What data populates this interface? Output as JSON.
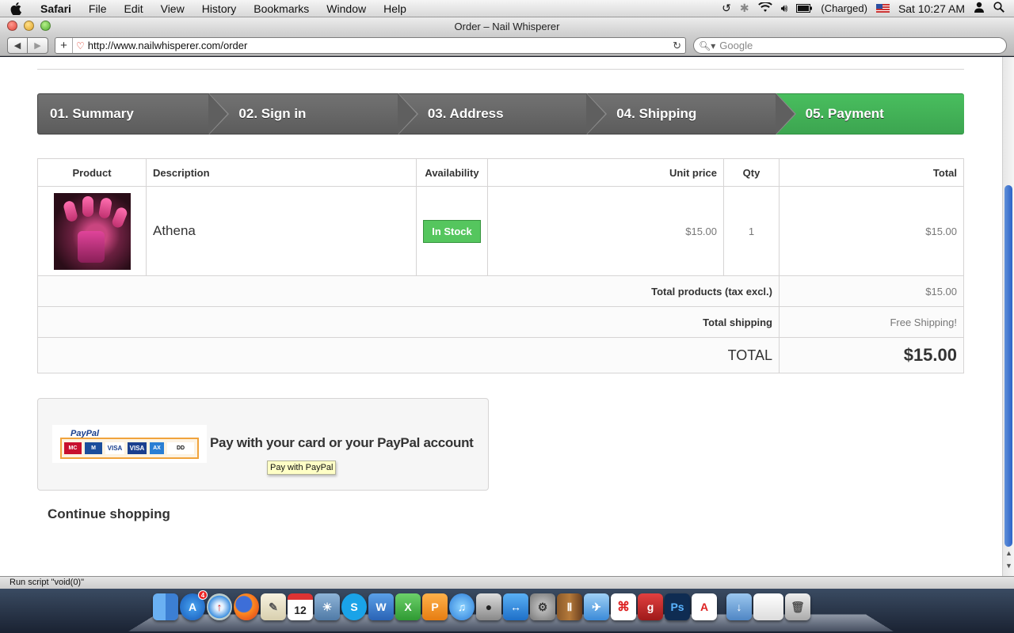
{
  "menubar": {
    "app": "Safari",
    "items": [
      "File",
      "Edit",
      "View",
      "History",
      "Bookmarks",
      "Window",
      "Help"
    ],
    "battery": "(Charged)",
    "clock": "Sat 10:27 AM"
  },
  "window": {
    "title": "Order – Nail Whisperer"
  },
  "toolbar": {
    "url": "http://www.nailwhisperer.com/order",
    "search_placeholder": "Google"
  },
  "steps": [
    {
      "label": "01. Summary",
      "state": "done"
    },
    {
      "label": "02. Sign in",
      "state": "done"
    },
    {
      "label": "03. Address",
      "state": "done"
    },
    {
      "label": "04. Shipping",
      "state": "done"
    },
    {
      "label": "05. Payment",
      "state": "current"
    }
  ],
  "cart": {
    "headers": [
      "Product",
      "Description",
      "Availability",
      "Unit price",
      "Qty",
      "Total"
    ],
    "item": {
      "description": "Athena",
      "availability": "In Stock",
      "unit_price": "$15.00",
      "qty": "1",
      "total": "$15.00"
    },
    "total_products_label": "Total products (tax excl.)",
    "total_products_value": "$15.00",
    "total_shipping_label": "Total shipping",
    "total_shipping_value": "Free Shipping!",
    "grand_total_label": "TOTAL",
    "grand_total_value": "$15.00"
  },
  "payment": {
    "paypal_logo_text": "PayPal",
    "text": "Pay with your card or your PayPal account",
    "tooltip": "Pay with PayPal",
    "cards": [
      "MasterCard",
      "Maestro",
      "VISA",
      "VISA",
      "AmEx",
      "DIRECT Debit"
    ]
  },
  "continue_label": "Continue shopping",
  "status_text": "Run script \"void(0)\"",
  "dock": {
    "app_store_badge": "4",
    "calendar_day": "12"
  },
  "colors": {
    "step_bg": "#666666",
    "step_current": "#46b95b",
    "in_stock": "#55c65e",
    "tooltip_bg": "#ffffc6"
  }
}
